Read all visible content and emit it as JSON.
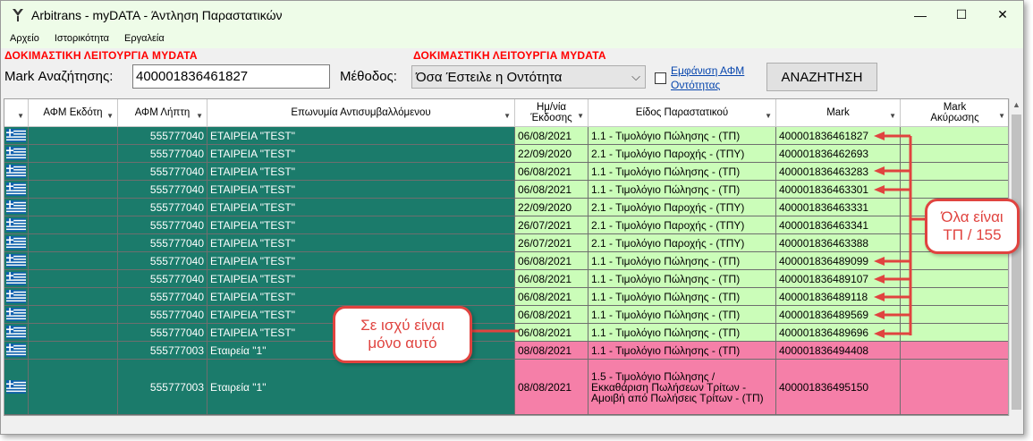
{
  "window": {
    "title": "Arbitrans - myDATA - Άντληση Παραστατικών",
    "minimize": "—",
    "maximize": "☐",
    "close": "✕"
  },
  "menu": [
    "Αρχείο",
    "Ιστορικότητα",
    "Εργαλεία"
  ],
  "search": {
    "warning": "ΔΟΚΙΜΑΣΤΙΚΗ ΛΕΙΤΟΥΡΓΙΑ MYDATA",
    "mark_label": "Mark Αναζήτησης:",
    "mark_value": "400001836461827",
    "method_label": "Μέθοδος:",
    "method_value": "Όσα Έστειλε η Οντότητα",
    "show_afm_line1": "Εμφάνιση ΑΦΜ",
    "show_afm_line2": "Οντότητας",
    "search_button": "ΑΝΑΖΗΤΗΣΗ"
  },
  "columns": [
    "",
    "ΑΦΜ Εκδότη",
    "ΑΦΜ Λήπτη",
    "Επωνυμία Αντισυμβαλλόμενου",
    "Ημ/νία Έκδοσης",
    "Είδος Παραστατικού",
    "Mark",
    "Mark Ακύρωσης"
  ],
  "rows": [
    {
      "issuer": "",
      "receiver": "555777040",
      "name": "ΕΤΑΙΡΕΙΑ \"TEST\"",
      "date": "06/08/2021",
      "type": "1.1 - Τιμολόγιο Πώλησης - (ΤΠ)",
      "mark": "400001836461827",
      "cancel": "",
      "status": "green"
    },
    {
      "issuer": "",
      "receiver": "555777040",
      "name": "ΕΤΑΙΡΕΙΑ \"TEST\"",
      "date": "22/09/2020",
      "type": "2.1 - Τιμολόγιο Παροχής - (ΤΠΥ)",
      "mark": "400001836462693",
      "cancel": "",
      "status": "green"
    },
    {
      "issuer": "",
      "receiver": "555777040",
      "name": "ΕΤΑΙΡΕΙΑ \"TEST\"",
      "date": "06/08/2021",
      "type": "1.1 - Τιμολόγιο Πώλησης - (ΤΠ)",
      "mark": "400001836463283",
      "cancel": "",
      "status": "green"
    },
    {
      "issuer": "",
      "receiver": "555777040",
      "name": "ΕΤΑΙΡΕΙΑ \"TEST\"",
      "date": "06/08/2021",
      "type": "1.1 - Τιμολόγιο Πώλησης - (ΤΠ)",
      "mark": "400001836463301",
      "cancel": "",
      "status": "green"
    },
    {
      "issuer": "",
      "receiver": "555777040",
      "name": "ΕΤΑΙΡΕΙΑ \"TEST\"",
      "date": "22/09/2020",
      "type": "2.1 - Τιμολόγιο Παροχής - (ΤΠΥ)",
      "mark": "400001836463331",
      "cancel": "",
      "status": "green"
    },
    {
      "issuer": "",
      "receiver": "555777040",
      "name": "ΕΤΑΙΡΕΙΑ \"TEST\"",
      "date": "26/07/2021",
      "type": "2.1 - Τιμολόγιο Παροχής - (ΤΠΥ)",
      "mark": "400001836463341",
      "cancel": "",
      "status": "green"
    },
    {
      "issuer": "",
      "receiver": "555777040",
      "name": "ΕΤΑΙΡΕΙΑ \"TEST\"",
      "date": "26/07/2021",
      "type": "2.1 - Τιμολόγιο Παροχής - (ΤΠΥ)",
      "mark": "400001836463388",
      "cancel": "",
      "status": "green"
    },
    {
      "issuer": "",
      "receiver": "555777040",
      "name": "ΕΤΑΙΡΕΙΑ \"TEST\"",
      "date": "06/08/2021",
      "type": "1.1 - Τιμολόγιο Πώλησης - (ΤΠ)",
      "mark": "400001836489099",
      "cancel": "",
      "status": "green"
    },
    {
      "issuer": "",
      "receiver": "555777040",
      "name": "ΕΤΑΙΡΕΙΑ \"TEST\"",
      "date": "06/08/2021",
      "type": "1.1 - Τιμολόγιο Πώλησης - (ΤΠ)",
      "mark": "400001836489107",
      "cancel": "",
      "status": "green"
    },
    {
      "issuer": "",
      "receiver": "555777040",
      "name": "ΕΤΑΙΡΕΙΑ \"TEST\"",
      "date": "06/08/2021",
      "type": "1.1 - Τιμολόγιο Πώλησης - (ΤΠ)",
      "mark": "400001836489118",
      "cancel": "",
      "status": "green"
    },
    {
      "issuer": "",
      "receiver": "555777040",
      "name": "ΕΤΑΙΡΕΙΑ \"TEST\"",
      "date": "06/08/2021",
      "type": "1.1 - Τιμολόγιο Πώλησης - (ΤΠ)",
      "mark": "400001836489569",
      "cancel": "",
      "status": "green"
    },
    {
      "issuer": "",
      "receiver": "555777040",
      "name": "ΕΤΑΙΡΕΙΑ \"TEST\"",
      "date": "06/08/2021",
      "type": "1.1 - Τιμολόγιο Πώλησης - (ΤΠ)",
      "mark": "400001836489696",
      "cancel": "",
      "status": "green"
    },
    {
      "issuer": "",
      "receiver": "555777003",
      "name": "Εταιρεία \"1\"",
      "date": "08/08/2021",
      "type": "1.1 - Τιμολόγιο Πώλησης - (ΤΠ)",
      "mark": "400001836494408",
      "cancel": "",
      "status": "pink"
    },
    {
      "issuer": "",
      "receiver": "555777003",
      "name": "Εταιρεία \"1\"",
      "date": "08/08/2021",
      "type": "1.5 - Τιμολόγιο Πώλησης / Εκκαθάριση Πωλήσεων Τρίτων - Αμοιβή από Πωλήσεις Τρίτων - (ΤΠ)",
      "mark": "400001836495150",
      "cancel": "",
      "status": "pink"
    }
  ],
  "annotations": {
    "all_tp_line1": "Όλα είναι",
    "all_tp_line2": "ΤΠ / 155",
    "only_valid_line1": "Σε ισχύ είναι",
    "only_valid_line2": "μόνο αυτό"
  },
  "colors": {
    "teal": "#1b7b6b",
    "green_row": "#cbfdb9",
    "pink_row": "#f57fa8",
    "annotation_red": "#e0433f",
    "warning_red": "#ff0000"
  }
}
